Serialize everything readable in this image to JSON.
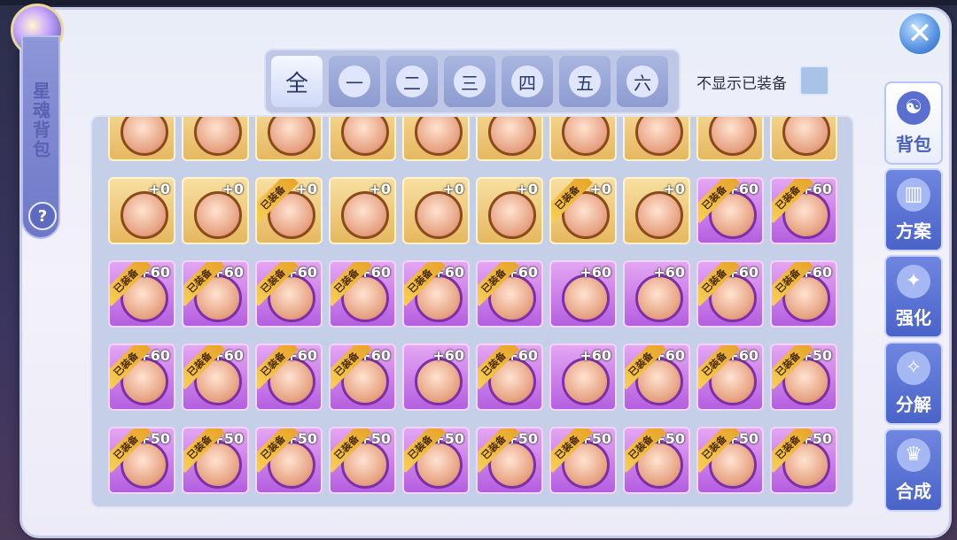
{
  "title": "星魂背包",
  "help_label": "?",
  "close_label": "✕",
  "tabs": [
    "全",
    "一",
    "二",
    "三",
    "四",
    "五",
    "六"
  ],
  "active_tab": 0,
  "filter_label": "不显示已装备",
  "equipped_tag": "已装备",
  "side_nav": [
    {
      "label": "背包",
      "icon": "bag-icon",
      "glyph": "☯"
    },
    {
      "label": "方案",
      "icon": "book-icon",
      "glyph": "▥"
    },
    {
      "label": "强化",
      "icon": "enhance-icon",
      "glyph": "✦"
    },
    {
      "label": "分解",
      "icon": "decompose-icon",
      "glyph": "✧"
    },
    {
      "label": "合成",
      "icon": "compose-icon",
      "glyph": "♛"
    }
  ],
  "slots": [
    {
      "level": "",
      "equipped": false,
      "color": "gold"
    },
    {
      "level": "",
      "equipped": false,
      "color": "gold"
    },
    {
      "level": "",
      "equipped": false,
      "color": "gold"
    },
    {
      "level": "",
      "equipped": false,
      "color": "gold"
    },
    {
      "level": "",
      "equipped": false,
      "color": "gold"
    },
    {
      "level": "",
      "equipped": false,
      "color": "gold"
    },
    {
      "level": "",
      "equipped": false,
      "color": "gold"
    },
    {
      "level": "",
      "equipped": false,
      "color": "gold"
    },
    {
      "level": "",
      "equipped": false,
      "color": "gold"
    },
    {
      "level": "",
      "equipped": false,
      "color": "gold"
    },
    {
      "level": "+0",
      "equipped": false,
      "color": "gold"
    },
    {
      "level": "+0",
      "equipped": false,
      "color": "gold"
    },
    {
      "level": "+0",
      "equipped": true,
      "color": "gold"
    },
    {
      "level": "+0",
      "equipped": false,
      "color": "gold"
    },
    {
      "level": "+0",
      "equipped": false,
      "color": "gold"
    },
    {
      "level": "+0",
      "equipped": false,
      "color": "gold"
    },
    {
      "level": "+0",
      "equipped": true,
      "color": "gold"
    },
    {
      "level": "+0",
      "equipped": false,
      "color": "gold"
    },
    {
      "level": "+60",
      "equipped": true,
      "color": "purple"
    },
    {
      "level": "+60",
      "equipped": true,
      "color": "purple"
    },
    {
      "level": "+60",
      "equipped": true,
      "color": "purple"
    },
    {
      "level": "+60",
      "equipped": true,
      "color": "purple"
    },
    {
      "level": "+60",
      "equipped": true,
      "color": "purple"
    },
    {
      "level": "+60",
      "equipped": true,
      "color": "purple"
    },
    {
      "level": "+60",
      "equipped": true,
      "color": "purple"
    },
    {
      "level": "+60",
      "equipped": true,
      "color": "purple"
    },
    {
      "level": "+60",
      "equipped": false,
      "color": "purple"
    },
    {
      "level": "+60",
      "equipped": false,
      "color": "purple"
    },
    {
      "level": "+60",
      "equipped": true,
      "color": "purple"
    },
    {
      "level": "+60",
      "equipped": true,
      "color": "purple"
    },
    {
      "level": "+60",
      "equipped": true,
      "color": "purple"
    },
    {
      "level": "+60",
      "equipped": true,
      "color": "purple"
    },
    {
      "level": "+60",
      "equipped": true,
      "color": "purple"
    },
    {
      "level": "+60",
      "equipped": true,
      "color": "purple"
    },
    {
      "level": "+60",
      "equipped": false,
      "color": "purple"
    },
    {
      "level": "+60",
      "equipped": true,
      "color": "purple"
    },
    {
      "level": "+60",
      "equipped": false,
      "color": "purple"
    },
    {
      "level": "+60",
      "equipped": true,
      "color": "purple"
    },
    {
      "level": "+60",
      "equipped": true,
      "color": "purple"
    },
    {
      "level": "+50",
      "equipped": true,
      "color": "purple"
    },
    {
      "level": "+50",
      "equipped": true,
      "color": "purple"
    },
    {
      "level": "+50",
      "equipped": true,
      "color": "purple"
    },
    {
      "level": "+50",
      "equipped": true,
      "color": "purple"
    },
    {
      "level": "+50",
      "equipped": true,
      "color": "purple"
    },
    {
      "level": "+50",
      "equipped": true,
      "color": "purple"
    },
    {
      "level": "+50",
      "equipped": true,
      "color": "purple"
    },
    {
      "level": "+50",
      "equipped": true,
      "color": "purple"
    },
    {
      "level": "+50",
      "equipped": true,
      "color": "purple"
    },
    {
      "level": "+50",
      "equipped": true,
      "color": "purple"
    },
    {
      "level": "+50",
      "equipped": true,
      "color": "purple"
    }
  ]
}
